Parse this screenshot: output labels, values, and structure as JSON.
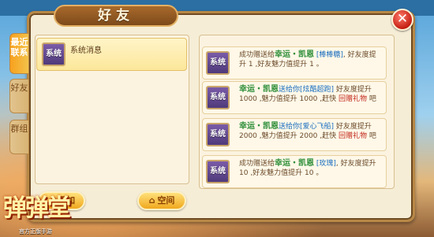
{
  "window": {
    "title": "好友",
    "close_glyph": "✕"
  },
  "tabs": [
    {
      "label": "最近联系",
      "active": true
    },
    {
      "label": "好友",
      "active": false
    },
    {
      "label": "群组",
      "active": false
    }
  ],
  "left_list": {
    "items": [
      {
        "avatar_text": "系统",
        "label": "系统消息"
      }
    ]
  },
  "buttons": {
    "add": {
      "icon": "person-plus-icon",
      "glyph": "+",
      "label": "添加"
    },
    "space": {
      "icon": "house-icon",
      "glyph": "⌂",
      "label": "空间"
    }
  },
  "messages": [
    {
      "avatar_text": "系统",
      "prefix": "成功赠送给",
      "name": "幸运・凯恩",
      "gift": "[棒棒糖]",
      "suffix": ", 好友度提升 1 ,好友魅力值提升 1 。",
      "extra": "",
      "end": ""
    },
    {
      "avatar_text": "系统",
      "prefix": "",
      "name": "幸运・凯恩",
      "gift": "送给你[炫酷超跑]",
      "suffix": " 好友度提升 1000 ,魅力值提升 1000 ,赶快 ",
      "extra": "回赠礼物",
      "end": " 吧"
    },
    {
      "avatar_text": "系统",
      "prefix": "",
      "name": "幸运・凯恩",
      "gift": "送给你[爱心飞船]",
      "suffix": " 好友度提升 2000 ,魅力值提升 2000 ,赶快 ",
      "extra": "回赠礼物",
      "end": " 吧"
    },
    {
      "avatar_text": "系统",
      "prefix": "成功赠送给",
      "name": "幸运・凯恩",
      "gift": "[玫瑰]",
      "suffix": ", 好友度提升 10 ,好友魅力值提升 10 。",
      "extra": "",
      "end": ""
    }
  ],
  "logo": {
    "title": "弹弹堂",
    "subtitle": "官方正版手游"
  },
  "colors": {
    "accent": "#f0a81e",
    "name_green": "#2f8f3a",
    "gift_blue": "#1b6fc0",
    "reply_red": "#c0261a"
  }
}
